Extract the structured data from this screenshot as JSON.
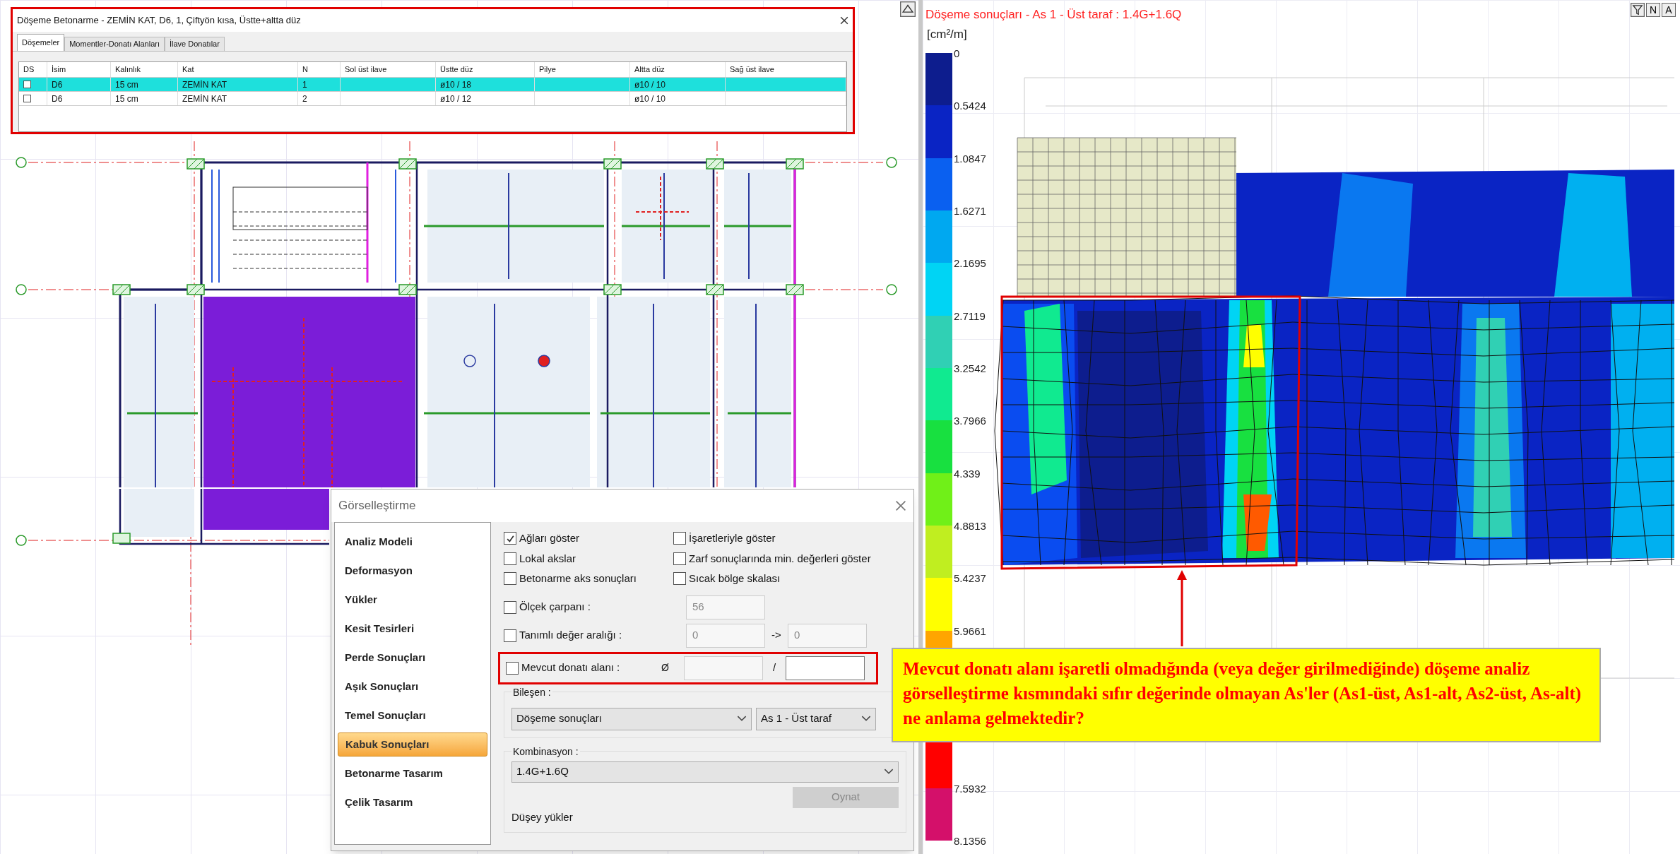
{
  "slab_dialog": {
    "title": "Döşeme Betonarme - ZEMİN KAT, D6, 1, Çiftyön kısa, Üstte+altta düz",
    "tabs": [
      {
        "label": "Döşemeler",
        "selected": true
      },
      {
        "label": "Momentler-Donatı Alanları",
        "selected": false
      },
      {
        "label": "İlave Donatılar",
        "selected": false
      }
    ],
    "columns": [
      "DS",
      "İsim",
      "Kalınlık",
      "Kat",
      "N",
      "Sol üst ilave",
      "Üstte düz",
      "Pilye",
      "Altta düz",
      "Sağ üst ilave"
    ],
    "rows": [
      {
        "selected": true,
        "checked": false,
        "name": "D6",
        "thickness": "15 cm",
        "floor": "ZEMİN KAT",
        "n": "1",
        "top_straight": "ø10 / 18",
        "bottom_straight": "ø10 / 10"
      },
      {
        "selected": false,
        "checked": false,
        "name": "D6",
        "thickness": "15 cm",
        "floor": "ZEMİN KAT",
        "n": "2",
        "top_straight": "ø10 / 12",
        "bottom_straight": "ø10 / 10"
      }
    ]
  },
  "visualization_dialog": {
    "title": "Görselleştirme",
    "menu": [
      {
        "label": "Analiz Modeli",
        "selected": false
      },
      {
        "label": "Deformasyon",
        "selected": false
      },
      {
        "label": "Yükler",
        "selected": false
      },
      {
        "label": "Kesit Tesirleri",
        "selected": false
      },
      {
        "label": "Perde Sonuçları",
        "selected": false
      },
      {
        "label": "Aşık Sonuçları",
        "selected": false
      },
      {
        "label": "Temel Sonuçları",
        "selected": false
      },
      {
        "label": "Kabuk Sonuçları",
        "selected": true
      },
      {
        "label": "Betonarme Tasarım",
        "selected": false
      },
      {
        "label": "Çelik Tasarım",
        "selected": false
      }
    ],
    "options": [
      {
        "label": "Ağları göster",
        "checked": true
      },
      {
        "label": "İşaretleriyle göster",
        "checked": false
      },
      {
        "label": "Lokal akslar",
        "checked": false
      },
      {
        "label": "Zarf sonuçlarında min. değerleri göster",
        "checked": false
      },
      {
        "label": "Betonarme aks sonuçları",
        "checked": false
      },
      {
        "label": "Sıcak bölge skalası",
        "checked": false
      }
    ],
    "scale_factor": {
      "label": "Ölçek çarpanı :",
      "checked": false,
      "value": "56"
    },
    "value_range": {
      "label": "Tanımlı değer aralığı :",
      "checked": false,
      "from": "0",
      "arrow": "->",
      "to": "0"
    },
    "existing_rebar": {
      "label": "Mevcut donatı alanı :",
      "checked": false,
      "diameter_symbol": "Ø",
      "separator": "/"
    },
    "component": {
      "label": "Bileşen :",
      "result_type": "Döşeme sonuçları",
      "side": "As 1 - Üst taraf"
    },
    "combination": {
      "label": "Kombinasyon :",
      "value": "1.4G+1.6Q",
      "play_button": {
        "label": "Oynat",
        "disabled": true
      },
      "load_type": "Düşey yükler"
    }
  },
  "results_view": {
    "title": "Döşeme sonuçları - As 1 - Üst taraf : 1.4G+1.6Q",
    "toolbar_buttons": [
      "N",
      "A"
    ],
    "unit": "[cm²/m]",
    "legend": [
      {
        "label": "0",
        "color": "#0d1d8e"
      },
      {
        "label": "0.5424",
        "color": "#0a24c4"
      },
      {
        "label": "1.0847",
        "color": "#0a60f0"
      },
      {
        "label": "1.6271",
        "color": "#00a8f0"
      },
      {
        "label": "2.1695",
        "color": "#00d4f4"
      },
      {
        "label": "2.7119",
        "color": "#30d0b4"
      },
      {
        "label": "3.2542",
        "color": "#10ea90"
      },
      {
        "label": "3.7966",
        "color": "#18e040"
      },
      {
        "label": "4.339",
        "color": "#70f018"
      },
      {
        "label": "4.8813",
        "color": "#c0ee20"
      },
      {
        "label": "5.4237",
        "color": "#ffff00"
      },
      {
        "label": "5.9661",
        "color": "#ffa500"
      },
      {
        "color": "#ff0000"
      },
      {
        "label": "7.5932",
        "color": "#d4106a"
      }
    ],
    "max_label": "8.1356"
  },
  "callout": {
    "text": "Mevcut donatı alanı işaretli olmadığında (veya değer girilmediğinde) döşeme analiz görselleştirme kısmındaki sıfır değerinde olmayan As'ler (As1-üst, As1-alt, As2-üst, As-alt) ne anlama gelmektedir?"
  }
}
